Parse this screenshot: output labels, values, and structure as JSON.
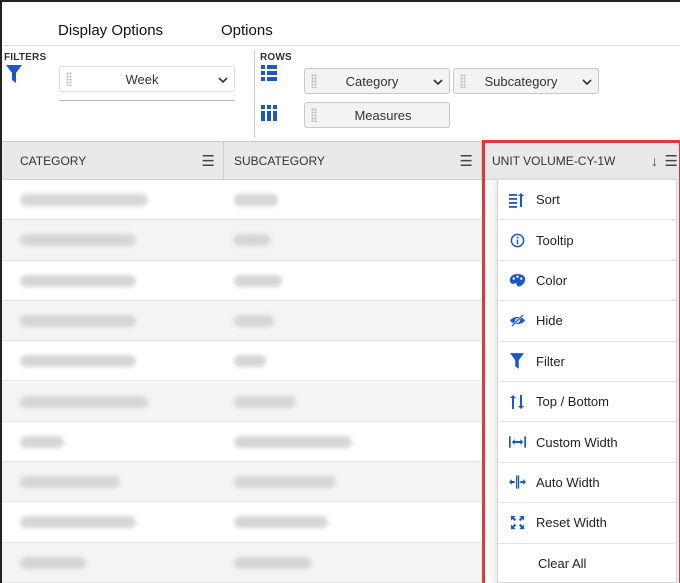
{
  "menubar": {
    "items": [
      "Display Options",
      "Options"
    ]
  },
  "filters": {
    "label": "FILTERS",
    "week_value": "Week"
  },
  "rows_config": {
    "label": "ROWS",
    "category": "Category",
    "subcategory": "Subcategory",
    "measures": "Measures"
  },
  "grid": {
    "headers": {
      "category": "CATEGORY",
      "subcategory": "SUBCATEGORY",
      "unit_volume": "UNIT VOLUME-CY-1W"
    },
    "sort_indicator": "↓",
    "menu_glyph": "☰"
  },
  "column_menu": {
    "items": [
      {
        "label": "Sort",
        "icon": "sort-icon"
      },
      {
        "label": "Tooltip",
        "icon": "info-icon"
      },
      {
        "label": "Color",
        "icon": "palette-icon"
      },
      {
        "label": "Hide",
        "icon": "eye-slash-icon"
      },
      {
        "label": "Filter",
        "icon": "filter-icon"
      },
      {
        "label": "Top / Bottom",
        "icon": "top-bottom-icon"
      },
      {
        "label": "Custom Width",
        "icon": "custom-width-icon"
      },
      {
        "label": "Auto Width",
        "icon": "auto-width-icon"
      },
      {
        "label": "Reset Width",
        "icon": "reset-width-icon"
      },
      {
        "label": "Clear All",
        "icon": ""
      }
    ]
  },
  "colors": {
    "accent_blue": "#1a57c8",
    "highlight_red": "#e0383b",
    "header_bg": "#e9e9e9"
  }
}
